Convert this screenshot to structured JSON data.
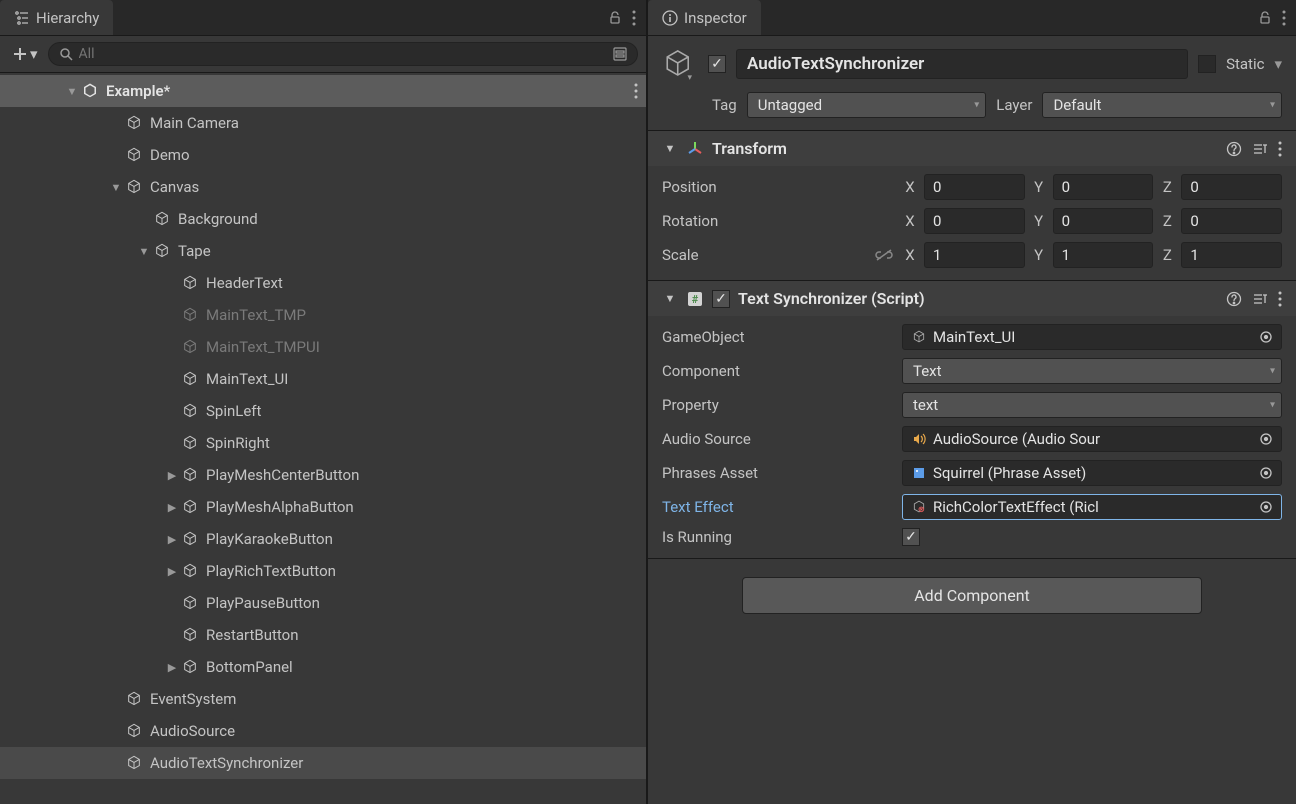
{
  "hierarchy": {
    "title": "Hierarchy",
    "search_placeholder": "All",
    "scene": "Example*",
    "items": [
      {
        "name": "Main Camera",
        "depth": 1
      },
      {
        "name": "Demo",
        "depth": 1
      },
      {
        "name": "Canvas",
        "depth": 1,
        "expanded": true
      },
      {
        "name": "Background",
        "depth": 2
      },
      {
        "name": "Tape",
        "depth": 2,
        "expanded": true
      },
      {
        "name": "HeaderText",
        "depth": 3
      },
      {
        "name": "MainText_TMP",
        "depth": 3,
        "disabled": true
      },
      {
        "name": "MainText_TMPUI",
        "depth": 3,
        "disabled": true
      },
      {
        "name": "MainText_UI",
        "depth": 3
      },
      {
        "name": "SpinLeft",
        "depth": 3
      },
      {
        "name": "SpinRight",
        "depth": 3
      },
      {
        "name": "PlayMeshCenterButton",
        "depth": 3,
        "collapsed": true
      },
      {
        "name": "PlayMeshAlphaButton",
        "depth": 3,
        "collapsed": true
      },
      {
        "name": "PlayKaraokeButton",
        "depth": 3,
        "collapsed": true
      },
      {
        "name": "PlayRichTextButton",
        "depth": 3,
        "collapsed": true
      },
      {
        "name": "PlayPauseButton",
        "depth": 3
      },
      {
        "name": "RestartButton",
        "depth": 3
      },
      {
        "name": "BottomPanel",
        "depth": 3,
        "collapsed": true
      },
      {
        "name": "EventSystem",
        "depth": 1
      },
      {
        "name": "AudioSource",
        "depth": 1
      },
      {
        "name": "AudioTextSynchronizer",
        "depth": 1,
        "selected": true
      }
    ]
  },
  "inspector": {
    "title": "Inspector",
    "enabled": true,
    "object_name": "AudioTextSynchronizer",
    "static_label": "Static",
    "tag_label": "Tag",
    "tag_value": "Untagged",
    "layer_label": "Layer",
    "layer_value": "Default",
    "transform": {
      "title": "Transform",
      "position_label": "Position",
      "rotation_label": "Rotation",
      "scale_label": "Scale",
      "position": {
        "x": "0",
        "y": "0",
        "z": "0"
      },
      "rotation": {
        "x": "0",
        "y": "0",
        "z": "0"
      },
      "scale": {
        "x": "1",
        "y": "1",
        "z": "1"
      }
    },
    "script": {
      "title": "Text Synchronizer (Script)",
      "enabled": true,
      "props": {
        "gameobject_label": "GameObject",
        "gameobject_value": "MainText_UI",
        "component_label": "Component",
        "component_value": "Text",
        "property_label": "Property",
        "property_value": "text",
        "audio_label": "Audio Source",
        "audio_value": "AudioSource (Audio Sour",
        "phrases_label": "Phrases Asset",
        "phrases_value": "Squirrel (Phrase Asset)",
        "effect_label": "Text Effect",
        "effect_value": "RichColorTextEffect (Ricl",
        "running_label": "Is Running",
        "running_value": true
      }
    },
    "add_component": "Add Component"
  }
}
